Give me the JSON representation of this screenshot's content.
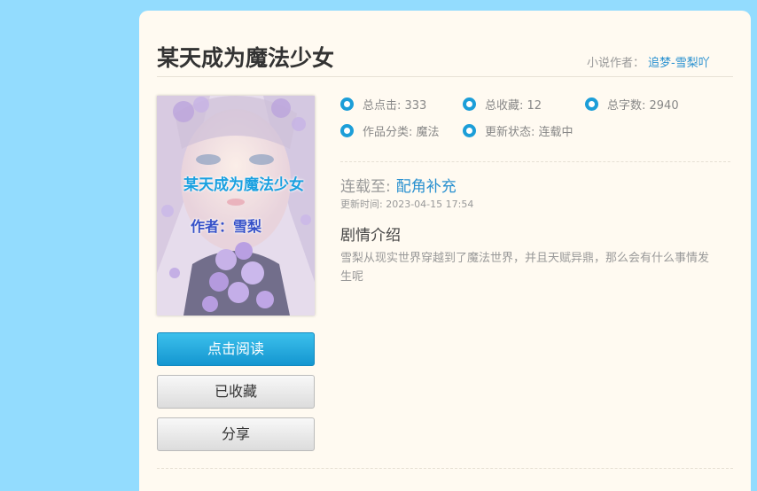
{
  "book": {
    "title": "某天成为魔法少女",
    "author_label": "小说作者：",
    "author_name": "追梦-雪梨吖"
  },
  "cover": {
    "title_text": "某天成为魔法少女",
    "author_text": "作者：雪梨"
  },
  "stats": {
    "clicks": "总点击: 333",
    "favorites": "总收藏: 12",
    "words": "总字数: 2940",
    "category": "作品分类: 魔法",
    "status": "更新状态: 连载中"
  },
  "latest": {
    "label": "连载至:",
    "chapter": "配角补充",
    "updated": "更新时间: 2023-04-15 17:54"
  },
  "synopsis": {
    "title": "剧情介绍",
    "text": "雪梨从现实世界穿越到了魔法世界，并且天赋异鼎，那么会有什么事情发生呢"
  },
  "buttons": {
    "read": "点击阅读",
    "favorited": "已收藏",
    "share": "分享"
  },
  "colors": {
    "page_bg": "#93dcfe",
    "card_bg": "#fffaf1",
    "accent": "#1c9ed8",
    "link": "#2a91d0"
  }
}
